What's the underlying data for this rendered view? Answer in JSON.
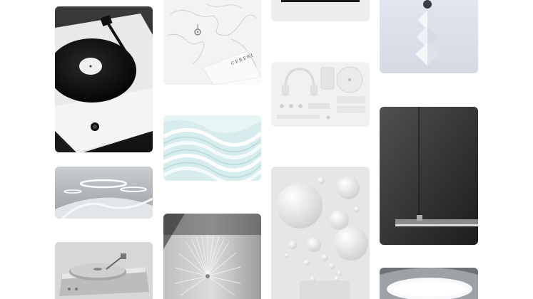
{
  "board": {
    "columns": 4,
    "tile_count": 13
  },
  "tiles": [
    {
      "id": "vinyl-turntable-black",
      "subject": "turntable-with-vinyl-record"
    },
    {
      "id": "world-map-stationery",
      "subject": "map-with-compass-and-card",
      "card_text": "CERERI"
    },
    {
      "id": "headphones-flatlay",
      "subject": "white-audio-equipment-flatlay"
    },
    {
      "id": "blue-wave-sculpture",
      "subject": "pale-blue-wave-layers"
    },
    {
      "id": "pendant-lamp-dark",
      "subject": "linear-pendant-lamp-on-dark-wall"
    },
    {
      "id": "diamond-stack",
      "subject": "white-stacked-diamonds"
    },
    {
      "id": "ring-light-room",
      "subject": "curved-room-with-ring-lights"
    },
    {
      "id": "white-spheres",
      "subject": "floating-white-spheres"
    },
    {
      "id": "radial-sculpture",
      "subject": "white-radial-wall-sculpture"
    },
    {
      "id": "silver-turntable",
      "subject": "silver-turntable"
    },
    {
      "id": "ceiling-light-arc",
      "subject": "curved-ceiling-light"
    },
    {
      "id": "top-dark-device",
      "subject": "dark-device-on-white"
    }
  ],
  "colors": {
    "background": "#ffffff",
    "dark_tile": "#2a2a2a",
    "light_tile": "#eeeeee",
    "accent_blue": "#cfe6e8"
  }
}
